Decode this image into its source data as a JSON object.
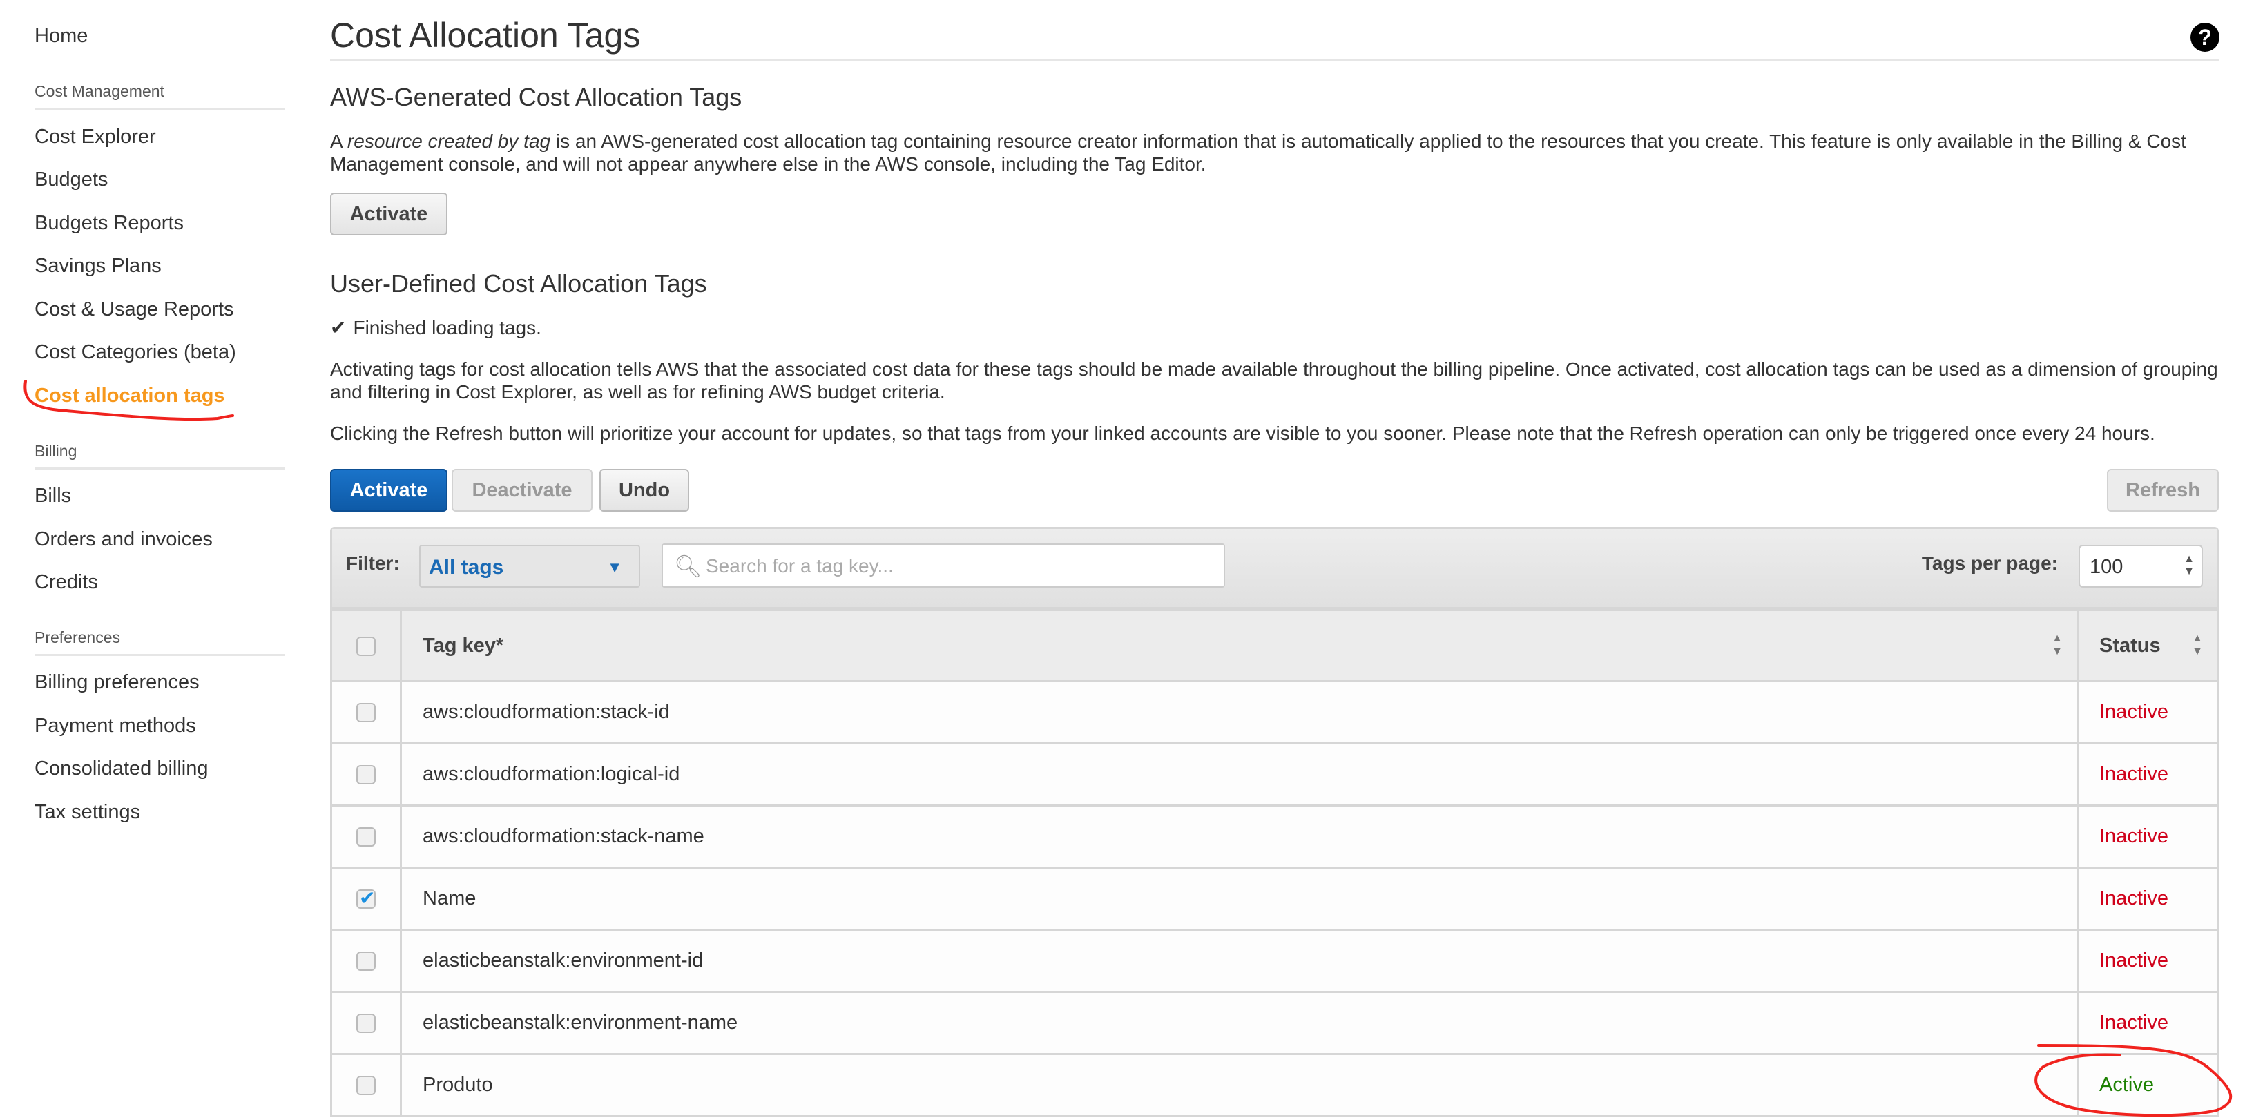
{
  "sidebar": {
    "home": "Home",
    "sections": [
      {
        "title": "Cost Management",
        "items": [
          "Cost Explorer",
          "Budgets",
          "Budgets Reports",
          "Savings Plans",
          "Cost & Usage Reports",
          "Cost Categories (beta)",
          "Cost allocation tags"
        ]
      },
      {
        "title": "Billing",
        "items": [
          "Bills",
          "Orders and invoices",
          "Credits"
        ]
      },
      {
        "title": "Preferences",
        "items": [
          "Billing preferences",
          "Payment methods",
          "Consolidated billing",
          "Tax settings"
        ]
      }
    ],
    "active_item": "Cost allocation tags",
    "active_color": "#f7981d"
  },
  "page": {
    "title": "Cost Allocation Tags",
    "help_icon": "?"
  },
  "aws_generated": {
    "title": "AWS-Generated Cost Allocation Tags",
    "desc_prefix": "A ",
    "desc_em": "resource created by tag",
    "desc_rest": " is an AWS-generated cost allocation tag containing resource creator information that is automatically applied to the resources that you create. This feature is only available in the Billing & Cost Management console, and will not appear anywhere else in the AWS console, including the Tag Editor.",
    "activate_label": "Activate"
  },
  "user_defined": {
    "title": "User-Defined Cost Allocation Tags",
    "loading_status": "Finished loading tags.",
    "desc1": "Activating tags for cost allocation tells AWS that the associated cost data for these tags should be made available throughout the billing pipeline. Once activated, cost allocation tags can be used as a dimension of grouping and filtering in Cost Explorer, as well as for refining AWS budget criteria.",
    "desc2": "Clicking the Refresh button will prioritize your account for updates, so that tags from your linked accounts are visible to you sooner. Please note that the Refresh operation can only be triggered once every 24 hours.",
    "buttons": {
      "activate": "Activate",
      "deactivate": "Deactivate",
      "undo": "Undo",
      "refresh": "Refresh"
    }
  },
  "filter": {
    "label": "Filter:",
    "selected": "All tags",
    "search_placeholder": "Search for a tag key...",
    "per_page_label": "Tags per page:",
    "per_page_value": "100"
  },
  "table": {
    "columns": [
      "Tag key*",
      "Status"
    ],
    "rows": [
      {
        "key": "aws:cloudformation:stack-id",
        "status": "Inactive",
        "checked": false
      },
      {
        "key": "aws:cloudformation:logical-id",
        "status": "Inactive",
        "checked": false
      },
      {
        "key": "aws:cloudformation:stack-name",
        "status": "Inactive",
        "checked": false
      },
      {
        "key": "Name",
        "status": "Inactive",
        "checked": true
      },
      {
        "key": "elasticbeanstalk:environment-id",
        "status": "Inactive",
        "checked": false
      },
      {
        "key": "elasticbeanstalk:environment-name",
        "status": "Inactive",
        "checked": false
      },
      {
        "key": "Produto",
        "status": "Active",
        "checked": false
      }
    ],
    "status_colors": {
      "Inactive": "#d0021b",
      "Active": "#1d8102"
    }
  }
}
